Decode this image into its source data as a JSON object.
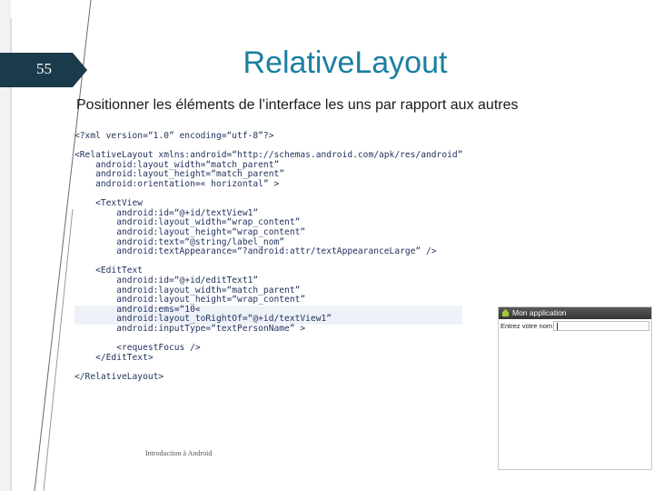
{
  "slide": {
    "number": "55",
    "title": "RelativeLayout",
    "subtitle": "Positionner les éléments de  l’interface  les uns par rapport aux autres",
    "footer": "Introduction à Android",
    "accent_color": "#1a7fa0",
    "tab_color": "#1b3a4b"
  },
  "code_lines": [
    "<?xml version=“1.0” encoding=“utf-8”?>",
    "",
    "<RelativeLayout xmlns:android=“http://schemas.android.com/apk/res/android”",
    "    android:layout_width=“match_parent”",
    "    android:layout_height=“match_parent”",
    "    android:orientation=« horizontal” >",
    "",
    "    <TextView",
    "        android:id=“@+id/textView1”",
    "        android:layout_width=“wrap_content”",
    "        android:layout_height=“wrap_content”",
    "        android:text=“@string/label_nom”",
    "        android:textAppearance=“?android:attr/textAppearanceLarge” />",
    "",
    "    <EditText",
    "        android:id=“@+id/editText1”",
    "        android:layout_width=“match_parent”",
    "        android:layout_height=“wrap_content”",
    "        android:ems=“10«",
    "        android:layout_toRightOf=“@+id/textView1”",
    "        android:inputType=“textPersonName” >",
    "",
    "        <requestFocus />",
    "    </EditText>",
    "",
    "</RelativeLayout>"
  ],
  "device_preview": {
    "app_title": "Mon application",
    "field_label": "Entrez votre nom",
    "field_value": ""
  }
}
